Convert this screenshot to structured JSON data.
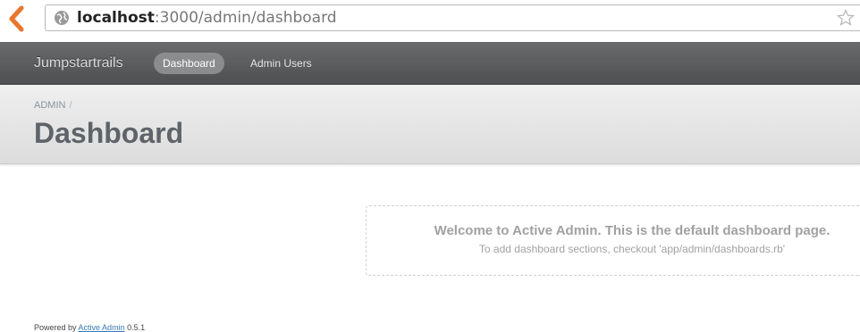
{
  "browser": {
    "url_host": "localhost",
    "url_rest": ":3000/admin/dashboard"
  },
  "header": {
    "site_title": "Jumpstartrails",
    "nav": [
      {
        "label": "Dashboard",
        "active": true
      },
      {
        "label": "Admin Users",
        "active": false
      }
    ]
  },
  "title_bar": {
    "breadcrumb": "ADMIN",
    "breadcrumb_separator": "/",
    "page_title": "Dashboard"
  },
  "blank_slate": {
    "welcome": "Welcome to Active Admin. This is the default dashboard page.",
    "hint": "To add dashboard sections, checkout 'app/admin/dashboards.rb'"
  },
  "footer": {
    "prefix": "Powered by",
    "link": "Active Admin",
    "version": "0.5.1"
  },
  "colors": {
    "header_bg": "#5c5d5f",
    "nav_active_bg": "#8b8c8e",
    "title_text": "#5e6469",
    "back_arrow": "#e8772e",
    "link": "#3778b7"
  }
}
